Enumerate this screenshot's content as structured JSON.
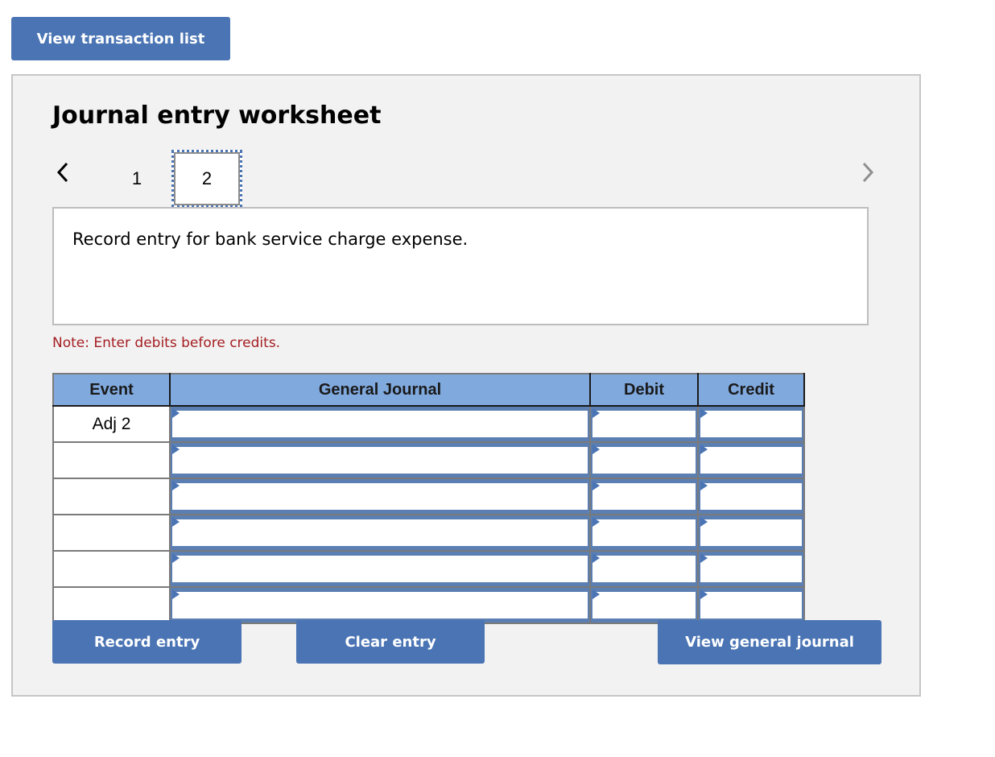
{
  "top_button": {
    "label": "View transaction list"
  },
  "worksheet": {
    "title": "Journal entry worksheet",
    "pagination": {
      "prev_icon": "chevron-left-icon",
      "next_icon": "chevron-right-icon",
      "pages": [
        "1",
        "2"
      ],
      "current_page": "2"
    },
    "description": "Record entry for bank service charge expense.",
    "note": "Note: Enter debits before credits.",
    "table": {
      "headers": [
        "Event",
        "General Journal",
        "Debit",
        "Credit"
      ],
      "rows": [
        {
          "event": "Adj 2",
          "general_journal": "",
          "debit": "",
          "credit": ""
        },
        {
          "event": "",
          "general_journal": "",
          "debit": "",
          "credit": ""
        },
        {
          "event": "",
          "general_journal": "",
          "debit": "",
          "credit": ""
        },
        {
          "event": "",
          "general_journal": "",
          "debit": "",
          "credit": ""
        },
        {
          "event": "",
          "general_journal": "",
          "debit": "",
          "credit": ""
        },
        {
          "event": "",
          "general_journal": "",
          "debit": "",
          "credit": ""
        }
      ]
    },
    "buttons": {
      "record": "Record entry",
      "clear": "Clear entry",
      "view_journal": "View general journal"
    }
  },
  "colors": {
    "button_blue": "#4a74b4",
    "header_blue": "#80a9de",
    "note_red": "#a51e22",
    "panel_bg": "#f2f2f2"
  }
}
